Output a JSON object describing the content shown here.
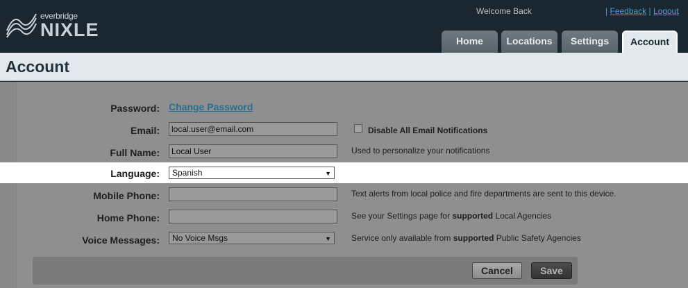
{
  "brand": {
    "small": "everbridge",
    "big": "NIXLE"
  },
  "header": {
    "welcome": "Welcome Back",
    "links": {
      "feedback": "Feedback",
      "logout": "Logout",
      "sep": "|"
    }
  },
  "tabs": [
    {
      "label": "Home"
    },
    {
      "label": "Locations"
    },
    {
      "label": "Settings"
    },
    {
      "label": "Account",
      "active": true
    }
  ],
  "page": {
    "title": "Account"
  },
  "form": {
    "password": {
      "label": "Password:",
      "link": "Change Password"
    },
    "email": {
      "label": "Email:",
      "value": "local.user@email.com",
      "checkbox_label": "Disable All Email Notifications",
      "checkbox_checked": false
    },
    "full_name": {
      "label": "Full Name:",
      "value": "Local User",
      "hint": "Used to personalize your notifications"
    },
    "language": {
      "label": "Language:",
      "value": "Spanish"
    },
    "mobile_phone": {
      "label": "Mobile Phone:",
      "value": "",
      "hint": "Text alerts from local police and fire departments are sent to this device."
    },
    "home_phone": {
      "label": "Home Phone:",
      "value": "",
      "hint_pre": "See your Settings page for ",
      "hint_bold": "supported",
      "hint_post": " Local Agencies"
    },
    "voice_messages": {
      "label": "Voice Messages:",
      "value": "No Voice Msgs",
      "hint_pre": "Service only available from ",
      "hint_bold": "supported",
      "hint_post": " Public Safety Agencies"
    }
  },
  "buttons": {
    "cancel": "Cancel",
    "save": "Save"
  }
}
